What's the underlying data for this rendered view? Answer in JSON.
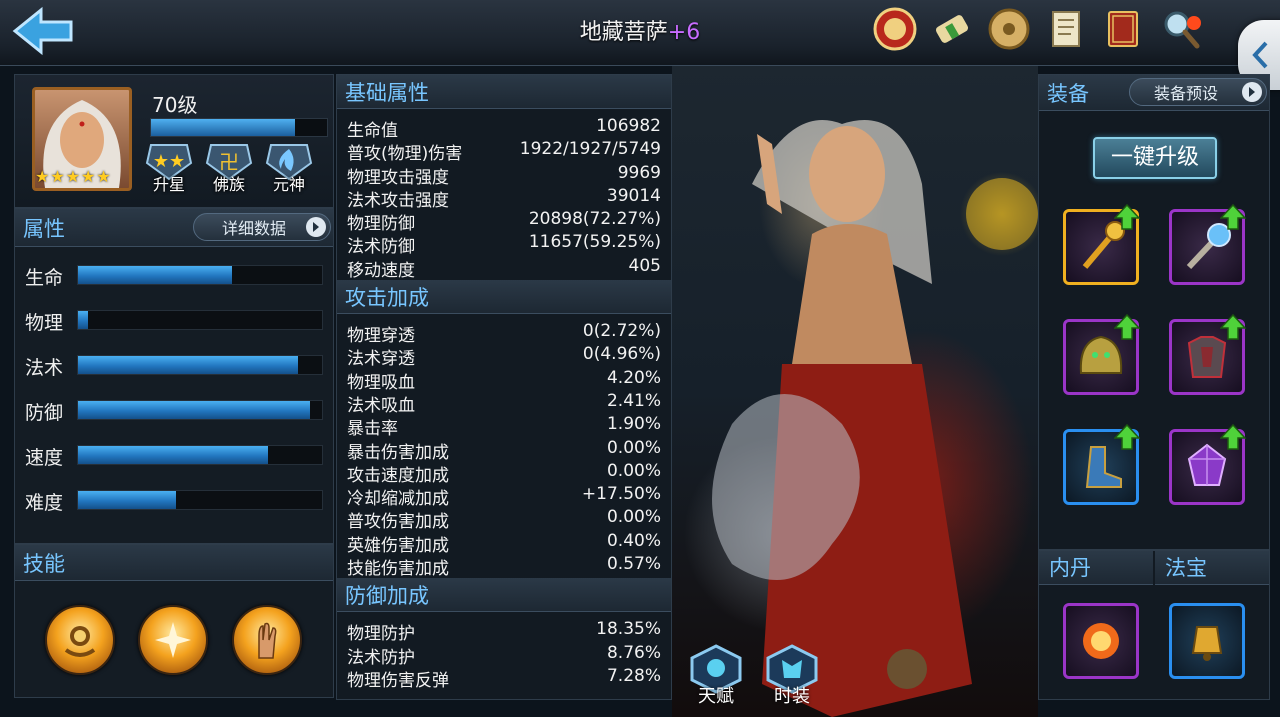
{
  "header": {
    "title": "地藏菩萨",
    "title_suffix": "+6",
    "icons": [
      "battle-seal-icon",
      "scroll-icon",
      "gold-coin-icon",
      "quest-scroll-icon",
      "book-icon",
      "magnifier-icon"
    ]
  },
  "hero": {
    "level": "70级",
    "exp_fraction": 0.82,
    "stars": 5,
    "badges": [
      {
        "label": "升星",
        "icon": "stars-icon"
      },
      {
        "label": "佛族",
        "icon": "buddhist-emblem-icon"
      },
      {
        "label": "元神",
        "icon": "spirit-flame-icon"
      }
    ]
  },
  "attributes": {
    "title": "属性",
    "detail_button": "详细数据",
    "rows": [
      {
        "label": "生命",
        "value": 0.63
      },
      {
        "label": "物理",
        "value": 0.04
      },
      {
        "label": "法术",
        "value": 0.9
      },
      {
        "label": "防御",
        "value": 0.95
      },
      {
        "label": "速度",
        "value": 0.78
      },
      {
        "label": "难度",
        "value": 0.4
      }
    ]
  },
  "skills": {
    "title": "技能",
    "items": [
      "prayer-beads-skill-icon",
      "light-palm-skill-icon",
      "mudra-hand-skill-icon"
    ]
  },
  "stats": {
    "sections": [
      {
        "title": "基础属性",
        "rows": [
          [
            "生命值",
            "106982"
          ],
          [
            "普攻(物理)伤害",
            "1922/1927/5749"
          ],
          [
            "物理攻击强度",
            "9969"
          ],
          [
            "法术攻击强度",
            "39014"
          ],
          [
            "物理防御",
            "20898(72.27%)"
          ],
          [
            "法术防御",
            "11657(59.25%)"
          ],
          [
            "移动速度",
            "405"
          ]
        ]
      },
      {
        "title": "攻击加成",
        "rows": [
          [
            "物理穿透",
            "0(2.72%)"
          ],
          [
            "法术穿透",
            "0(4.96%)"
          ],
          [
            "物理吸血",
            "4.20%"
          ],
          [
            "法术吸血",
            "2.41%"
          ],
          [
            "暴击率",
            "1.90%"
          ],
          [
            "暴击伤害加成",
            "0.00%"
          ],
          [
            "攻击速度加成",
            "0.00%"
          ],
          [
            "冷却缩减加成",
            "+17.50%"
          ],
          [
            "普攻伤害加成",
            "0.00%"
          ],
          [
            "英雄伤害加成",
            "0.40%"
          ],
          [
            "技能伤害加成",
            "0.57%"
          ]
        ]
      },
      {
        "title": "防御加成",
        "rows": [
          [
            "物理防护",
            "18.35%"
          ],
          [
            "法术防护",
            "8.76%"
          ],
          [
            "物理伤害反弹",
            "7.28%"
          ]
        ]
      }
    ]
  },
  "equipment": {
    "title": "装备",
    "preset_button": "装备预设",
    "upgrade_button": "一键升级",
    "slots": [
      {
        "icon": "golden-staff-icon",
        "quality": "gold",
        "upgradable": true
      },
      {
        "icon": "crystal-mace-icon",
        "quality": "purple",
        "upgradable": true
      },
      {
        "icon": "lion-helmet-icon",
        "quality": "purple",
        "upgradable": true
      },
      {
        "icon": "armor-icon",
        "quality": "purple",
        "upgradable": true
      },
      {
        "icon": "boots-icon",
        "quality": "blue",
        "upgradable": true
      },
      {
        "icon": "purple-gem-icon",
        "quality": "purple",
        "upgradable": true
      }
    ]
  },
  "inner_core": {
    "title": "内丹",
    "icon": "fire-orb-icon"
  },
  "treasure": {
    "title": "法宝",
    "icon": "golden-bell-icon"
  },
  "bottom_tabs": [
    {
      "label": "天赋",
      "icon": "talent-icon"
    },
    {
      "label": "时装",
      "icon": "costume-icon"
    }
  ],
  "colors": {
    "accent_blue": "#78c6ff",
    "title_plus": "#c86cff",
    "bar_blue": "#2277c0",
    "upgrade_green": "#4fd23a"
  }
}
